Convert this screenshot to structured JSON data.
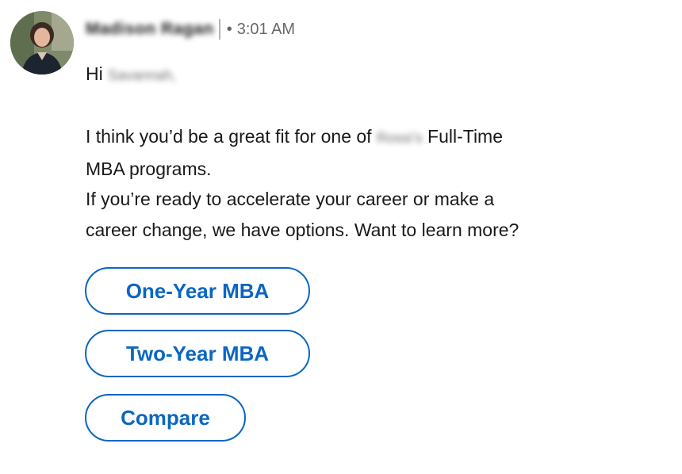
{
  "message": {
    "sender_name": "Madison Ragan",
    "timestamp_separator": "•",
    "timestamp": "3:01 AM",
    "greeting_prefix": "Hi",
    "greeting_name": "Savannah,",
    "paragraph_line1_prefix": "I think you’d be a great fit for one of",
    "school_name": "Rossi’s",
    "paragraph_line1_suffix": "Full-Time",
    "paragraph_line2": "MBA programs.",
    "paragraph_line3": "If you’re ready to accelerate your career or make a",
    "paragraph_line4": "career change, we have options. Want to learn more?"
  },
  "quick_replies": [
    {
      "label": "One-Year MBA"
    },
    {
      "label": "Two-Year MBA"
    },
    {
      "label": "Compare"
    }
  ],
  "colors": {
    "accent": "#0a66c2",
    "text": "#1f1f1f",
    "meta": "#666666"
  }
}
